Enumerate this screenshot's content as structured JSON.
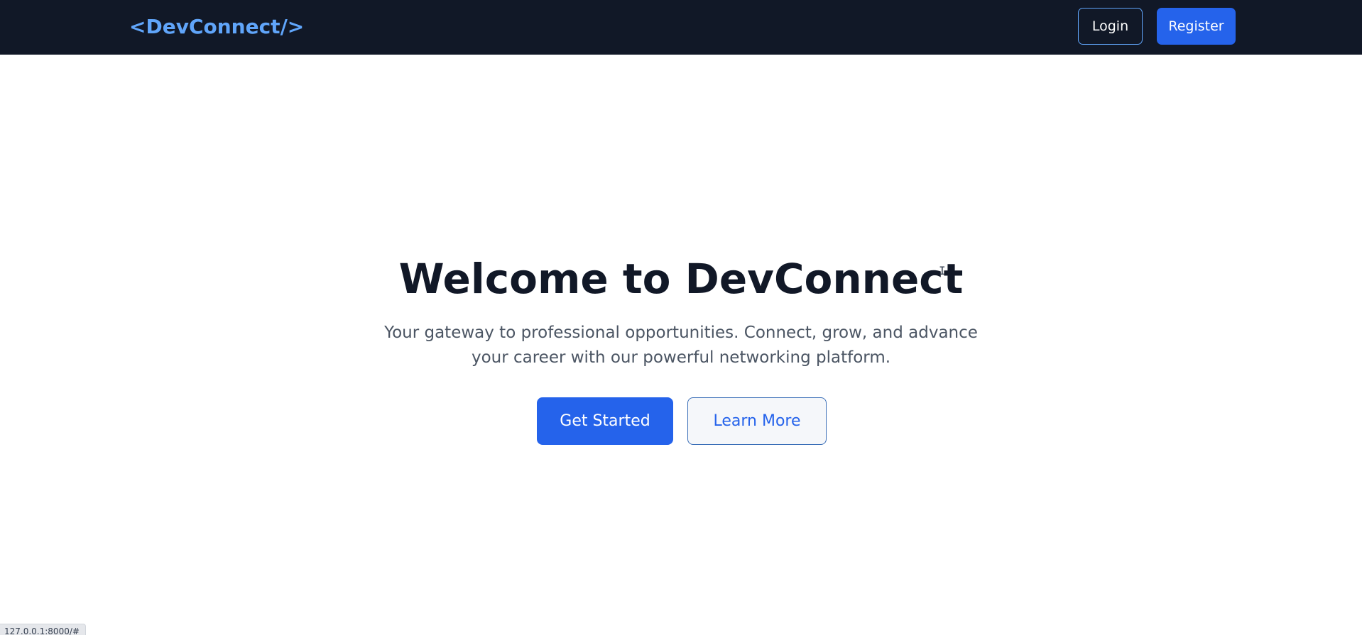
{
  "navbar": {
    "logo": "<DevConnect/>",
    "login_label": "Login",
    "register_label": "Register"
  },
  "hero": {
    "title": "Welcome to DevConnect",
    "subtitle": "Your gateway to professional opportunities. Connect, grow, and advance your career with our powerful networking platform.",
    "primary_cta": "Get Started",
    "secondary_cta": "Learn More"
  },
  "status_bar": {
    "url": "127.0.0.1:8000/#"
  },
  "cursor_glyph": "I",
  "colors": {
    "navbar_bg": "#111827",
    "logo": "#60a5fa",
    "primary": "#2563eb",
    "title": "#111827",
    "subtitle": "#4b5563"
  }
}
